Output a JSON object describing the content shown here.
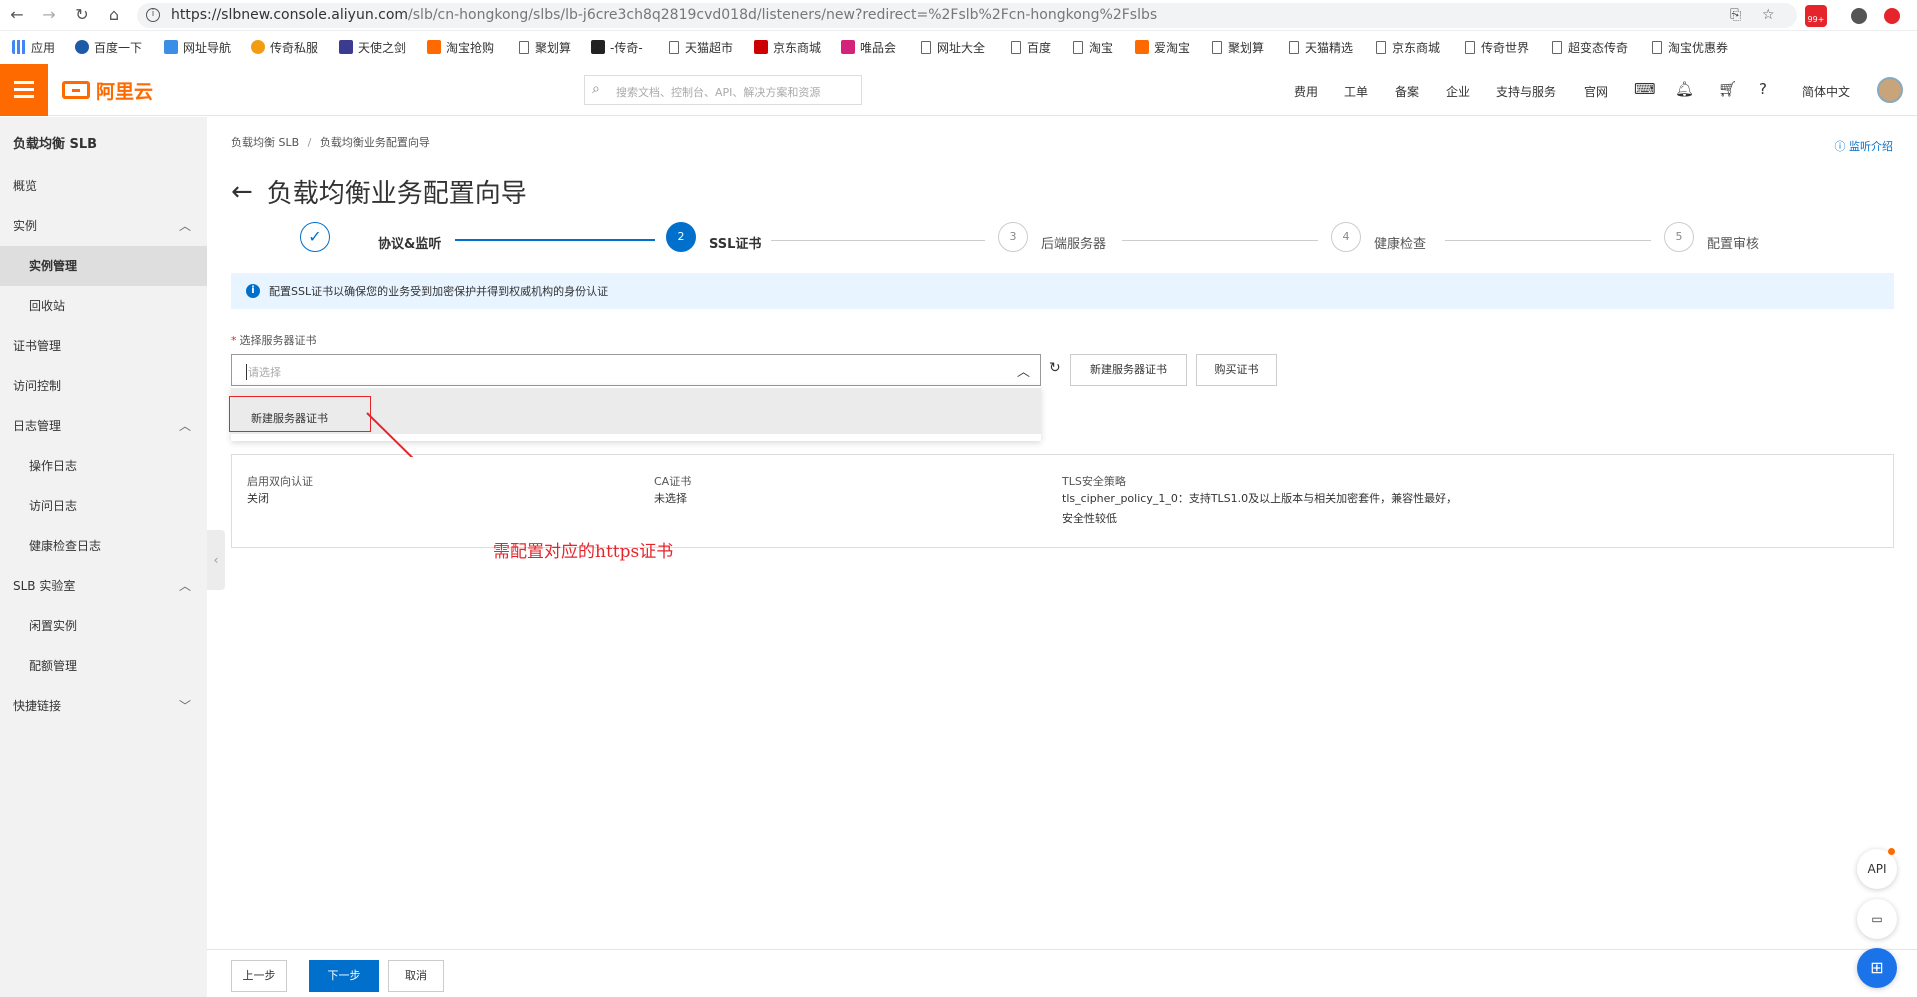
{
  "browser": {
    "url_host": "https://slbnew.console.aliyun.com",
    "url_path": "/slb/cn-hongkong/slbs/lb-j6cre3ch8q2819cvd018d/listeners/new?redirect=%2Fslb%2Fcn-hongkong%2Fslbs",
    "ext_badge": "99+"
  },
  "bookmarks": [
    "应用",
    "百度一下",
    "网址导航",
    "传奇私服",
    "天使之剑",
    "淘宝抢购",
    "聚划算",
    "-传奇-",
    "天猫超市",
    "京东商城",
    "唯品会",
    "网址大全",
    "百度",
    "淘宝",
    "爱淘宝",
    "聚划算",
    "天猫精选",
    "京东商城",
    "传奇世界",
    "超变态传奇",
    "淘宝优惠券"
  ],
  "topnav": {
    "logo_text": "阿里云",
    "search_placeholder": "搜索文档、控制台、API、解决方案和资源",
    "links": [
      "费用",
      "工单",
      "备案",
      "企业",
      "支持与服务",
      "官网"
    ],
    "language": "简体中文"
  },
  "sidebar": {
    "title": "负载均衡 SLB",
    "items": [
      "概览",
      "实例",
      "实例管理",
      "回收站",
      "证书管理",
      "访问控制",
      "日志管理",
      "操作日志",
      "访问日志",
      "健康检查日志",
      "SLB 实验室",
      "闲置实例",
      "配额管理",
      "快捷链接"
    ]
  },
  "main": {
    "breadcrumb_root": "负载均衡 SLB",
    "breadcrumb_sep": "/",
    "breadcrumb_current": "负载均衡业务配置向导",
    "help_link": "监听介绍",
    "title": "负载均衡业务配置向导",
    "steps": [
      {
        "num": "✓",
        "label": "协议&监听",
        "state": "done"
      },
      {
        "num": "2",
        "label": "SSL证书",
        "state": "current"
      },
      {
        "num": "3",
        "label": "后端服务器",
        "state": "todo"
      },
      {
        "num": "4",
        "label": "健康检查",
        "state": "todo"
      },
      {
        "num": "5",
        "label": "配置审核",
        "state": "todo"
      }
    ],
    "alert": "配置SSL证书以确保您的业务受到加密保护并得到权威机构的身份认证",
    "field_req": "*",
    "field_label": "选择服务器证书",
    "select_placeholder": "请选择",
    "dropdown_option": "新建服务器证书",
    "btn_new_cert": "新建服务器证书",
    "btn_buy_cert": "购买证书",
    "info": {
      "mutual_label": "启用双向认证",
      "mutual_value": "关闭",
      "ca_label": "CA证书",
      "ca_value": "未选择",
      "tls_label": "TLS安全策略",
      "tls_value_1": "tls_cipher_policy_1_0：支持TLS1.0及以上版本与相关加密套件，兼容性最好，",
      "tls_value_2": "安全性较低"
    },
    "annotation": "需配置对应的https证书",
    "footer": {
      "prev": "上一步",
      "next": "下一步",
      "cancel": "取消"
    }
  },
  "float": {
    "api": "API"
  }
}
